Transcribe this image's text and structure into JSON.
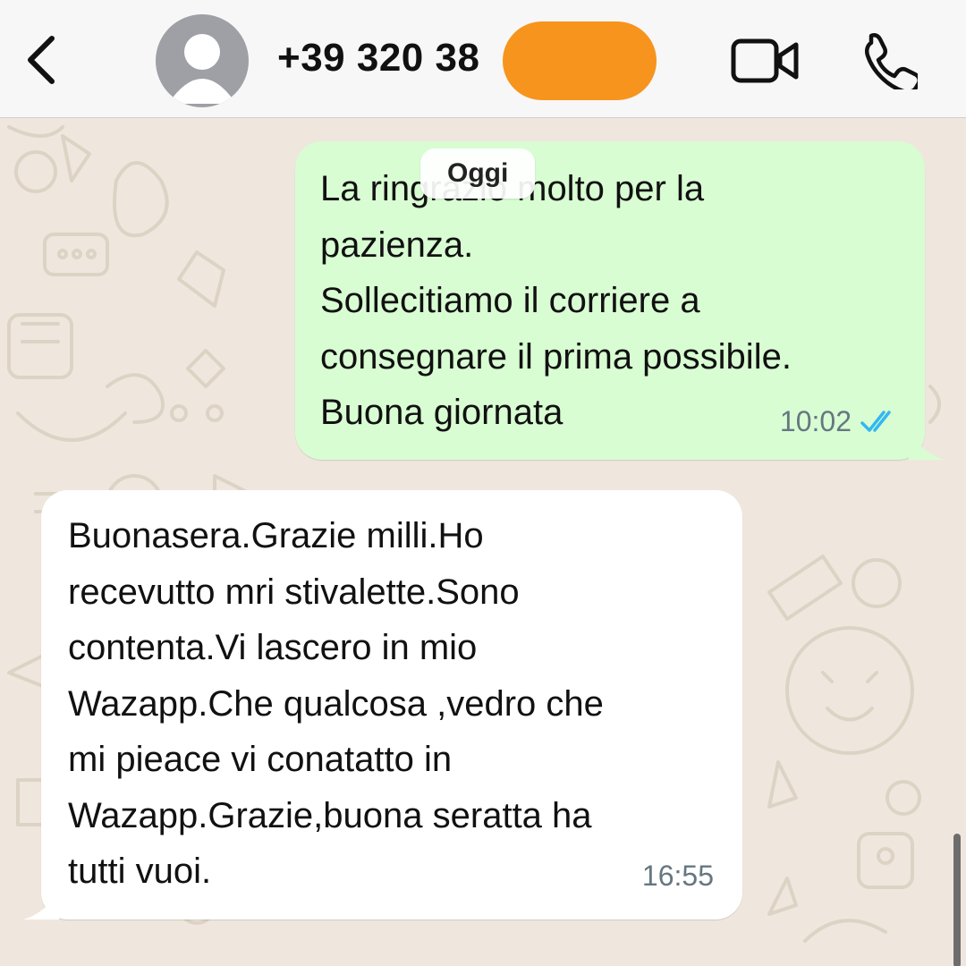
{
  "header": {
    "contact_name": "+39 320 38",
    "icons": {
      "back": "chevron-left-icon",
      "avatar": "person-icon",
      "video": "video-camera-icon",
      "call": "phone-icon"
    },
    "redaction_color": "#f7941d"
  },
  "date_separator": "Oggi",
  "messages": [
    {
      "direction": "outgoing",
      "text": "La ringrazio molto per la\npazienza.\nSollecitiamo il corriere a\nconsegnare il prima possibile.\nBuona giornata",
      "time": "10:02",
      "status": "read",
      "status_icon": "double-check-icon",
      "bubble_color": "#d9fdd3",
      "status_color": "#34b7f1"
    },
    {
      "direction": "incoming",
      "text": "Buonasera.Grazie milli.Ho\nrecevutto mri stivalette.Sono\ncontenta.Vi lascero in mio\nWazapp.Che qualcosa ,vedro che\nmi pieace vi conatatto in\nWazapp.Grazie,buona seratta ha\ntutti vuoi.",
      "time": "16:55",
      "bubble_color": "#ffffff"
    }
  ]
}
